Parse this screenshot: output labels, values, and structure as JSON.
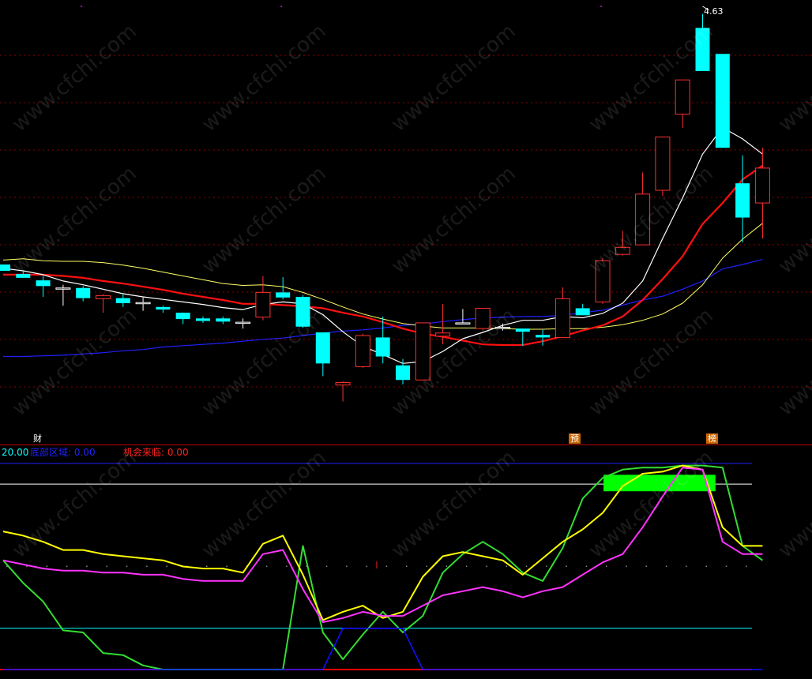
{
  "watermark": "www.cfchi.com",
  "price_panel": {
    "y_range": [
      0,
      4.8
    ],
    "high_label": "4.63",
    "markers": [
      {
        "text": "财",
        "index": 1,
        "color": "#FFFFFF",
        "bg": ""
      },
      {
        "text": "预",
        "index": 28,
        "color": "#FFFFFF",
        "bg": "#CC6600"
      },
      {
        "text": "榜",
        "index": 35,
        "color": "#FFFFFF",
        "bg": "#CC6600"
      }
    ]
  },
  "indicator_panel": {
    "legend": [
      {
        "text": "20.00",
        "color": "#00FFFF"
      },
      {
        "text": "底部区域: 0.00",
        "color": "#0000FF"
      },
      {
        "text": "机会来临: 0.00",
        "color": "#FF2020"
      }
    ],
    "y_range": [
      0,
      100
    ],
    "ref_lines": [
      {
        "value": 100,
        "color": "#2020FF"
      },
      {
        "value": 90,
        "color": "#FFFFFF"
      },
      {
        "value": 20,
        "color": "#00FFFF"
      },
      {
        "value": 0,
        "color": "#FF0000"
      }
    ]
  },
  "colors": {
    "up": "#FF3030",
    "down": "#00FFFF",
    "grid": "#8B0000",
    "ma_white": "#FFFFFF",
    "ma_red": "#FF1010",
    "ma_yellow": "#FFFF66",
    "ma_blue": "#2020FF",
    "ind_green": "#33DD33",
    "ind_yellow": "#FFFF00",
    "ind_magenta": "#FF33FF",
    "ind_blue": "#1010FF",
    "signal_bar": "#00FF00"
  },
  "chart_data": [
    {
      "type": "candlestick",
      "candles": [
        {
          "o": 0.56,
          "h": 0.56,
          "l": 0.46,
          "c": 0.46
        },
        {
          "o": 0.41,
          "h": 0.47,
          "l": 0.35,
          "c": 0.35
        },
        {
          "o": 0.31,
          "h": 0.38,
          "l": 0.05,
          "c": 0.22
        },
        {
          "o": 0.19,
          "h": 0.24,
          "l": -0.09,
          "c": 0.19
        },
        {
          "o": 0.19,
          "h": 0.22,
          "l": -0.02,
          "c": 0.03
        },
        {
          "o": 0.02,
          "h": 0.09,
          "l": -0.2,
          "c": 0.07
        },
        {
          "o": 0.03,
          "h": 0.09,
          "l": -0.11,
          "c": -0.05
        },
        {
          "o": -0.04,
          "h": 0.04,
          "l": -0.17,
          "c": -0.04
        },
        {
          "o": -0.11,
          "h": -0.09,
          "l": -0.2,
          "c": -0.15
        },
        {
          "o": -0.2,
          "h": -0.2,
          "l": -0.38,
          "c": -0.3
        },
        {
          "o": -0.29,
          "h": -0.26,
          "l": -0.36,
          "c": -0.33
        },
        {
          "o": -0.29,
          "h": -0.26,
          "l": -0.38,
          "c": -0.34
        },
        {
          "o": -0.35,
          "h": -0.29,
          "l": -0.45,
          "c": -0.35
        },
        {
          "o": -0.27,
          "h": 0.38,
          "l": -0.32,
          "c": 0.12
        },
        {
          "o": 0.12,
          "h": 0.36,
          "l": 0.01,
          "c": 0.04
        },
        {
          "o": 0.05,
          "h": 0.08,
          "l": -0.44,
          "c": -0.42
        },
        {
          "o": -0.51,
          "h": -0.51,
          "l": -1.2,
          "c": -1.0
        },
        {
          "o": -1.34,
          "h": -1.28,
          "l": -1.6,
          "c": -1.3
        },
        {
          "o": -1.05,
          "h": -0.53,
          "l": -1.07,
          "c": -0.56
        },
        {
          "o": -0.59,
          "h": -0.26,
          "l": -1.0,
          "c": -0.89
        },
        {
          "o": -1.03,
          "h": -0.93,
          "l": -1.33,
          "c": -1.26
        },
        {
          "o": -1.26,
          "h": -0.36,
          "l": -1.19,
          "c": -0.36
        },
        {
          "o": -0.57,
          "h": -0.06,
          "l": -0.7,
          "c": -0.52
        },
        {
          "o": -0.36,
          "h": -0.14,
          "l": -0.38,
          "c": -0.36
        },
        {
          "o": -0.45,
          "h": -0.13,
          "l": -0.48,
          "c": -0.13
        },
        {
          "o": -0.43,
          "h": -0.37,
          "l": -0.48,
          "c": -0.43
        },
        {
          "o": -0.45,
          "h": -0.46,
          "l": -0.72,
          "c": -0.5
        },
        {
          "o": -0.55,
          "h": -0.47,
          "l": -0.72,
          "c": -0.59
        },
        {
          "o": -0.59,
          "h": 0.2,
          "l": -0.59,
          "c": 0.02
        },
        {
          "o": -0.13,
          "h": -0.06,
          "l": -0.24,
          "c": -0.24
        },
        {
          "o": -0.03,
          "h": 0.66,
          "l": -0.06,
          "c": 0.62
        },
        {
          "o": 0.72,
          "h": 1.09,
          "l": 0.7,
          "c": 0.83
        },
        {
          "o": 0.87,
          "h": 2.01,
          "l": 0.87,
          "c": 1.67
        },
        {
          "o": 1.73,
          "h": 2.57,
          "l": 1.64,
          "c": 2.57
        },
        {
          "o": 2.93,
          "h": 3.47,
          "l": 2.71,
          "c": 3.47
        },
        {
          "o": 4.29,
          "h": 4.51,
          "l": 3.99,
          "c": 3.61
        },
        {
          "o": 3.88,
          "h": 3.8,
          "l": 2.4,
          "c": 2.4
        },
        {
          "o": 1.84,
          "h": 2.28,
          "l": 0.91,
          "c": 1.3
        },
        {
          "o": 1.53,
          "h": 2.4,
          "l": 0.97,
          "c": 2.08
        }
      ],
      "ma_white": [
        0.5,
        0.46,
        0.4,
        0.3,
        0.24,
        0.17,
        0.1,
        0.05,
        0.01,
        -0.03,
        -0.07,
        -0.12,
        -0.15,
        -0.07,
        -0.03,
        -0.06,
        -0.23,
        -0.5,
        -0.73,
        -0.86,
        -1.0,
        -0.97,
        -0.81,
        -0.61,
        -0.51,
        -0.4,
        -0.32,
        -0.32,
        -0.26,
        -0.28,
        -0.21,
        -0.05,
        0.3,
        0.97,
        1.61,
        2.3,
        2.72,
        2.54,
        2.3
      ],
      "ma_red": [
        0.4,
        0.4,
        0.4,
        0.38,
        0.35,
        0.3,
        0.26,
        0.21,
        0.16,
        0.1,
        0.05,
        0.0,
        -0.06,
        -0.06,
        -0.08,
        -0.1,
        -0.13,
        -0.2,
        -0.26,
        -0.35,
        -0.45,
        -0.53,
        -0.58,
        -0.64,
        -0.7,
        -0.71,
        -0.71,
        -0.65,
        -0.57,
        -0.48,
        -0.4,
        -0.26,
        0.0,
        0.33,
        0.69,
        1.2,
        1.53,
        1.9,
        2.12
      ],
      "ma_yellow": [
        0.63,
        0.65,
        0.62,
        0.61,
        0.61,
        0.59,
        0.55,
        0.5,
        0.44,
        0.38,
        0.32,
        0.26,
        0.23,
        0.24,
        0.21,
        0.12,
        0.01,
        -0.11,
        -0.22,
        -0.3,
        -0.37,
        -0.41,
        -0.44,
        -0.44,
        -0.44,
        -0.45,
        -0.46,
        -0.46,
        -0.45,
        -0.45,
        -0.43,
        -0.39,
        -0.32,
        -0.22,
        -0.05,
        0.24,
        0.66,
        0.96,
        1.21
      ],
      "ma_blue": [
        -0.89,
        -0.89,
        -0.88,
        -0.87,
        -0.85,
        -0.83,
        -0.8,
        -0.78,
        -0.74,
        -0.72,
        -0.7,
        -0.68,
        -0.65,
        -0.62,
        -0.6,
        -0.56,
        -0.52,
        -0.49,
        -0.47,
        -0.44,
        -0.4,
        -0.38,
        -0.34,
        -0.31,
        -0.28,
        -0.27,
        -0.26,
        -0.26,
        -0.24,
        -0.2,
        -0.16,
        -0.08,
        0.0,
        0.06,
        0.17,
        0.3,
        0.49,
        0.56,
        0.64
      ]
    },
    {
      "type": "line",
      "x_count": 39,
      "series": [
        {
          "key": "green",
          "values": [
            53,
            42,
            33,
            19,
            18,
            8,
            7,
            2,
            0,
            0,
            0,
            0,
            0,
            0,
            0,
            60,
            18,
            5,
            17,
            28,
            18,
            26,
            47,
            56,
            62,
            56,
            47,
            43,
            59,
            83,
            93,
            97,
            98,
            98,
            99,
            99,
            98,
            60,
            53
          ]
        },
        {
          "key": "yellow",
          "values": [
            67,
            65,
            62,
            58,
            58,
            56,
            55,
            54,
            53,
            50,
            49,
            49,
            47,
            61,
            65,
            46,
            24,
            28,
            31,
            25,
            28,
            45,
            55,
            57,
            55,
            53,
            46,
            54,
            62,
            68,
            76,
            89,
            95,
            96,
            99,
            97,
            69,
            60,
            60
          ]
        },
        {
          "key": "magenta",
          "values": [
            53,
            51,
            49,
            48,
            48,
            47,
            47,
            46,
            46,
            44,
            43,
            43,
            43,
            56,
            58,
            39,
            23,
            25,
            28,
            26,
            26,
            31,
            36,
            38,
            40,
            38,
            35,
            38,
            40,
            46,
            52,
            56,
            69,
            84,
            98,
            97,
            62,
            56,
            56
          ]
        },
        {
          "key": "blue",
          "values": [
            0,
            0,
            0,
            0,
            0,
            0,
            0,
            0,
            0,
            0,
            0,
            0,
            0,
            0,
            0,
            0,
            0,
            20,
            20,
            20,
            20,
            0,
            0,
            0,
            0,
            0,
            0,
            0,
            0,
            0,
            0,
            0,
            0,
            0,
            0,
            0,
            0,
            0,
            0
          ]
        }
      ],
      "signal": {
        "from": 30.2,
        "to": 35.8,
        "value": 90.5
      }
    }
  ]
}
